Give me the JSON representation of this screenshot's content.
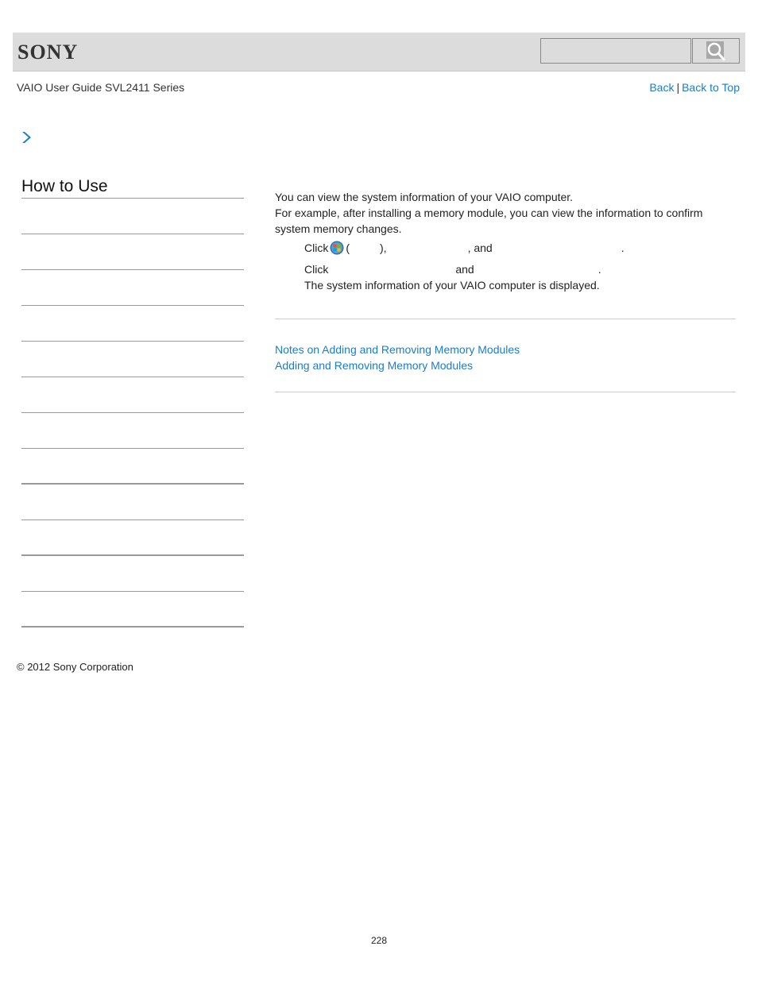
{
  "header": {
    "logo": "SONY",
    "search": {
      "placeholder": "",
      "button_icon": "search-icon"
    }
  },
  "guide_title": "VAIO User Guide SVL2411 Series",
  "top_links": {
    "back": "Back",
    "separator": "|",
    "back_to_top": "Back to Top"
  },
  "breadcrumb_icon": "chevron-right-icon",
  "sidebar": {
    "title": "How to Use",
    "item_count": 12
  },
  "content": {
    "intro_line1": "You can view the system information of your VAIO computer.",
    "intro_line2": "For example, after installing a memory module, you can view the information to confirm system memory changes.",
    "step1": {
      "click": "Click",
      "open_paren": "(",
      "close_paren": "),",
      "and": ", and",
      "period": ".",
      "icon": "windows-start-icon"
    },
    "step2": {
      "click": "Click",
      "and": "and",
      "period": "."
    },
    "step2_result": "The system information of your VAIO computer is displayed."
  },
  "related_links": [
    "Notes on Adding and Removing Memory Modules",
    "Adding and Removing Memory Modules"
  ],
  "footer": {
    "copyright": "© 2012 Sony Corporation",
    "page_number": "228"
  },
  "colors": {
    "link": "#1a7dc9",
    "header_bg": "#dcdcdc"
  }
}
